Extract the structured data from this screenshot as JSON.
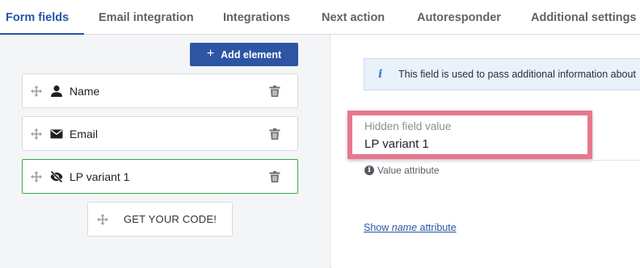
{
  "tabs": [
    {
      "label": "Form fields",
      "active": true
    },
    {
      "label": "Email integration",
      "active": false
    },
    {
      "label": "Integrations",
      "active": false
    },
    {
      "label": "Next action",
      "active": false
    },
    {
      "label": "Autoresponder",
      "active": false
    },
    {
      "label": "Additional settings",
      "active": false
    }
  ],
  "left_panel": {
    "add_button": {
      "icon": "plus-icon",
      "label": "Add element"
    },
    "fields": [
      {
        "icon": "person-icon",
        "label": "Name",
        "selected": false
      },
      {
        "icon": "envelope-icon",
        "label": "Email",
        "selected": false
      },
      {
        "icon": "eye-off-icon",
        "label": "LP variant 1",
        "selected": true
      }
    ],
    "submit_button": {
      "label": "GET YOUR CODE!"
    }
  },
  "right_panel": {
    "info_banner": {
      "icon": "info-icon",
      "text": "This field is used to pass additional information about"
    },
    "hidden_field": {
      "caption": "Hidden field value",
      "value": "LP variant 1"
    },
    "value_attribute": {
      "icon": "info-circle-icon",
      "label": "Value attribute"
    },
    "show_link": {
      "prefix": "Show ",
      "emphasis": "name",
      "suffix": " attribute"
    }
  },
  "colors": {
    "accent": "#2557a7",
    "button": "#2d55a3",
    "selected_border": "#3aa84a",
    "highlight_border": "#e8778c",
    "info_background": "#e9f1fb"
  }
}
